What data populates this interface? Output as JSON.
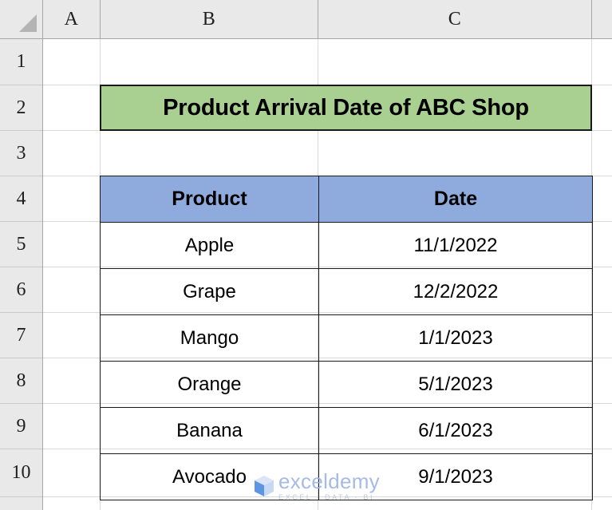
{
  "spreadsheet": {
    "select_all_icon": "select-all-triangle-icon",
    "column_headers": [
      "A",
      "B",
      "C"
    ],
    "row_headers": [
      "1",
      "2",
      "3",
      "4",
      "5",
      "6",
      "7",
      "8",
      "9",
      "10"
    ],
    "title_cell": {
      "text": "Product Arrival Date of ABC Shop",
      "fill_color": "#A9CF91",
      "border_color": "#1A1A1A"
    },
    "table": {
      "header_fill_color": "#8FAADC",
      "columns": [
        "Product",
        "Date"
      ],
      "rows": [
        {
          "product": "Apple",
          "date": "11/1/2022"
        },
        {
          "product": "Grape",
          "date": "12/2/2022"
        },
        {
          "product": "Mango",
          "date": "1/1/2023"
        },
        {
          "product": "Orange",
          "date": "5/1/2023"
        },
        {
          "product": "Banana",
          "date": "6/1/2023"
        },
        {
          "product": "Avocado",
          "date": "9/1/2023"
        }
      ]
    },
    "watermark": {
      "logo_icon": "exceldemy-cube-logo-icon",
      "name": "exceldemy",
      "tagline": "EXCEL · DATA · BI"
    }
  }
}
